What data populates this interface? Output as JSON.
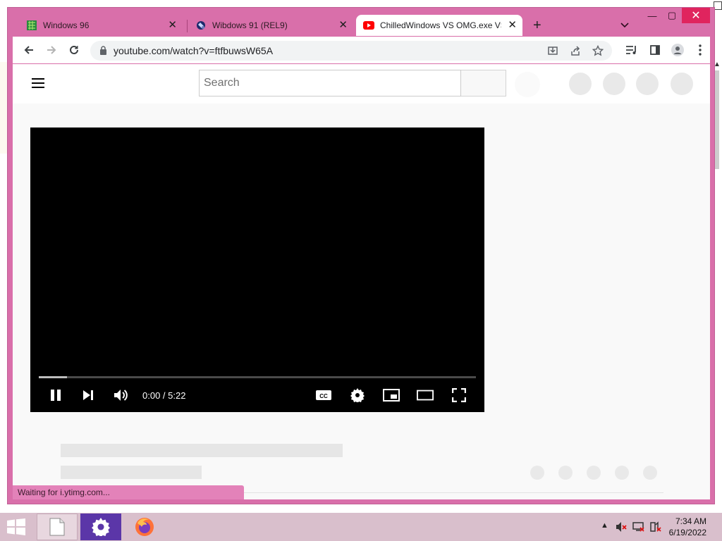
{
  "browser": {
    "tabs": [
      {
        "title": "Windows 96",
        "favicon": "windows96-icon",
        "active": false
      },
      {
        "title": "Wibdows 91 (REL9)",
        "favicon": "wibdows91-icon",
        "active": false
      },
      {
        "title": "ChilledWindows VS OMG.exe VS",
        "favicon": "youtube-icon",
        "active": true
      }
    ],
    "address": "youtube.com/watch?v=ftfbuwsW65A"
  },
  "youtube": {
    "search_placeholder": "Search",
    "search_value": ""
  },
  "player": {
    "time_text": "0:00 / 5:22",
    "played_fraction": 0.065,
    "state": "playing"
  },
  "status_bar": "Waiting for i.ytimg.com...",
  "taskbar": {
    "apps": [
      "file-explorer-icon",
      "settings-icon",
      "firefox-icon"
    ],
    "clock_time": "7:34 AM",
    "clock_date": "6/19/2022"
  },
  "colors": {
    "window_frame": "#d96faa",
    "youtube_red": "#ff0000",
    "taskbar": "#d9bfcc"
  }
}
